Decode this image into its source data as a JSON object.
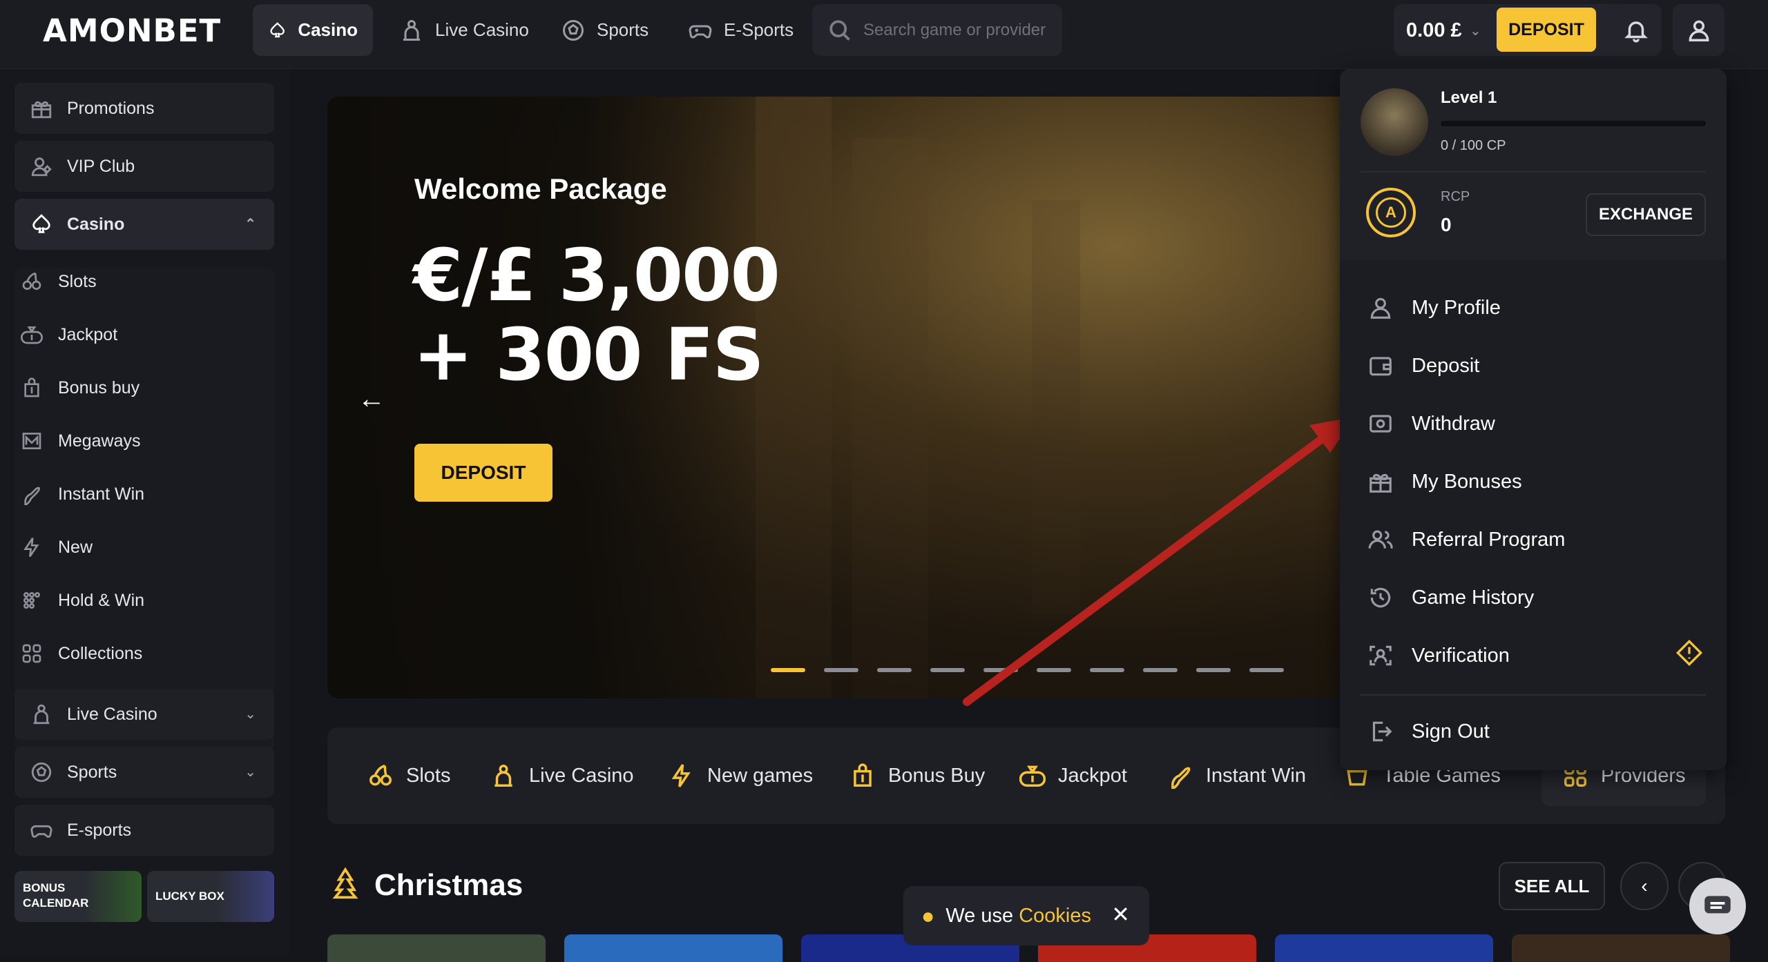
{
  "brand": {
    "logo": "AMONBET"
  },
  "topnav": {
    "items": [
      {
        "label": "Casino",
        "icon": "spade-icon"
      },
      {
        "label": "Live Casino",
        "icon": "dealer-icon"
      },
      {
        "label": "Sports",
        "icon": "soccer-ball-icon"
      },
      {
        "label": "E-Sports",
        "icon": "gamepad-icon"
      }
    ],
    "search_placeholder": "Search game or provider",
    "balance": "0.00 £",
    "deposit_label": "DEPOSIT"
  },
  "sidebar": {
    "top_items": [
      {
        "label": "Promotions",
        "icon": "gift-icon"
      },
      {
        "label": "VIP Club",
        "icon": "vip-icon"
      },
      {
        "label": "Casino",
        "icon": "spade-icon"
      }
    ],
    "casino_sub": [
      {
        "label": "Slots",
        "icon": "cherries-icon"
      },
      {
        "label": "Jackpot",
        "icon": "money-bag-icon"
      },
      {
        "label": "Bonus buy",
        "icon": "bonus-bag-icon"
      },
      {
        "label": "Megaways",
        "icon": "megaways-icon"
      },
      {
        "label": "Instant Win",
        "icon": "rocket-icon"
      },
      {
        "label": "New",
        "icon": "lightning-icon"
      },
      {
        "label": "Hold & Win",
        "icon": "hold-win-icon"
      },
      {
        "label": "Collections",
        "icon": "grid-icon"
      }
    ],
    "bottom_items": [
      {
        "label": "Live Casino",
        "icon": "dealer-icon"
      },
      {
        "label": "Sports",
        "icon": "soccer-ball-icon"
      },
      {
        "label": "E-sports",
        "icon": "gamepad-icon"
      }
    ],
    "tiles": [
      {
        "line1": "BONUS",
        "line2": "CALENDAR"
      },
      {
        "line1": "LUCKY BOX",
        "line2": ""
      }
    ]
  },
  "hero": {
    "title": "Welcome Package",
    "line1": "€/£ 3,000",
    "line2": "+ 300 FS",
    "button": "DEPOSIT",
    "slide_active": 0,
    "slide_count": 10
  },
  "categories": [
    {
      "label": "Slots",
      "icon": "cherries-icon"
    },
    {
      "label": "Live Casino",
      "icon": "dealer-icon"
    },
    {
      "label": "New games",
      "icon": "lightning-icon"
    },
    {
      "label": "Bonus Buy",
      "icon": "bonus-bag-icon"
    },
    {
      "label": "Jackpot",
      "icon": "money-bag-icon"
    },
    {
      "label": "Instant Win",
      "icon": "rocket-icon"
    },
    {
      "label": "Table Games",
      "icon": "table-icon"
    },
    {
      "label": "Providers",
      "icon": "grid-icon"
    }
  ],
  "section": {
    "title": "Christmas",
    "see_all": "SEE ALL"
  },
  "cookie": {
    "text": "We use",
    "link": "Cookies"
  },
  "profile_panel": {
    "level": "Level 1",
    "cp": "0 / 100 CP",
    "level_progress": 0,
    "rcp_label": "RCP",
    "rcp_value": "0",
    "exchange": "EXCHANGE",
    "menu": [
      {
        "label": "My Profile",
        "icon": "user-icon"
      },
      {
        "label": "Deposit",
        "icon": "wallet-icon"
      },
      {
        "label": "Withdraw",
        "icon": "withdraw-icon"
      },
      {
        "label": "My Bonuses",
        "icon": "gift-icon"
      },
      {
        "label": "Referral Program",
        "icon": "users-icon"
      },
      {
        "label": "Game History",
        "icon": "history-icon"
      },
      {
        "label": "Verification",
        "icon": "verification-icon"
      }
    ],
    "sign_out": "Sign Out"
  },
  "colors": {
    "accent": "#f6c434",
    "bg": "#15161b",
    "panel": "#1c1d23",
    "annotation_arrow": "#b8231f"
  }
}
